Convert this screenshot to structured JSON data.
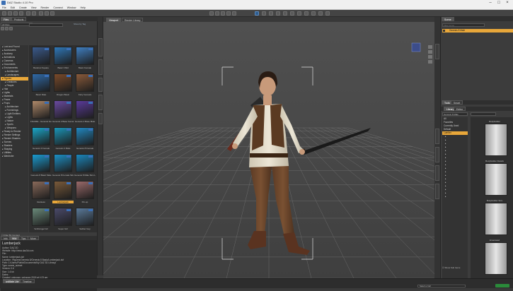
{
  "app": {
    "title": "DAZ Studio 4.10 Pro"
  },
  "menu": [
    "File",
    "Edit",
    "Create",
    "View",
    "Render",
    "Connect",
    "Window",
    "Help"
  ],
  "left_panel": {
    "tabs": [
      "Files",
      "Products"
    ],
    "path_dropdown": "All Files",
    "filter_link": "Show by Tag",
    "tree": [
      {
        "label": "Lost and Found",
        "selected": false
      },
      {
        "label": "Accessories",
        "selected": false
      },
      {
        "label": "Anatomy",
        "selected": false
      },
      {
        "label": "Animations",
        "selected": false
      },
      {
        "label": "Cameras",
        "selected": false
      },
      {
        "label": "Documents",
        "selected": false
      },
      {
        "label": "Environments",
        "selected": false
      },
      {
        "label": "Architecture",
        "selected": false
      },
      {
        "label": "Landscapes",
        "selected": false
      },
      {
        "label": "Figures",
        "selected": true
      },
      {
        "label": "Creatures",
        "selected": false
      },
      {
        "label": "People",
        "selected": false
      },
      {
        "label": "Hair",
        "selected": false
      },
      {
        "label": "Lights",
        "selected": false
      },
      {
        "label": "Materials",
        "selected": false
      },
      {
        "label": "Poses",
        "selected": false
      },
      {
        "label": "Props",
        "selected": false
      },
      {
        "label": "Architecture",
        "selected": false
      },
      {
        "label": "Furnishings",
        "selected": false
      },
      {
        "label": "Light Emitters",
        "selected": false
      },
      {
        "label": "Lights",
        "selected": false
      },
      {
        "label": "Nature",
        "selected": false
      },
      {
        "label": "Sports",
        "selected": false
      },
      {
        "label": "Weapons",
        "selected": false
      },
      {
        "label": "Ready to Render",
        "selected": false
      },
      {
        "label": "Render Settings",
        "selected": false
      },
      {
        "label": "Render Shaders",
        "selected": false
      },
      {
        "label": "Scenes",
        "selected": false
      },
      {
        "label": "Shaders",
        "selected": false
      },
      {
        "label": "Shaping",
        "selected": false
      },
      {
        "label": "Utilities",
        "selected": false
      },
      {
        "label": "Wardrobe",
        "selected": false
      }
    ],
    "filter_by_context": "Filter By Context",
    "thumbnails": [
      {
        "label": "Barefoot Square",
        "color": "#3a5a8c"
      },
      {
        "label": "Basic Child",
        "color": "#2f78b8"
      },
      {
        "label": "Basic Female",
        "color": "#3f7fc0"
      },
      {
        "label": "Basic Male",
        "color": "#2f6aa8"
      },
      {
        "label": "Dragon Basic",
        "color": "#7a4a2a"
      },
      {
        "label": "Fairy Genesis",
        "color": "#8a5a3a"
      },
      {
        "label": "FIGURE - Genesis Female",
        "color": "#b08a6a"
      },
      {
        "label": "Genesis 2 Base Female",
        "color": "#6a4aa0"
      },
      {
        "label": "Genesis 2 Base Male",
        "color": "#5a3a9a"
      },
      {
        "label": "Genesis 3 Female",
        "color": "#1aa6c8"
      },
      {
        "label": "Genesis 3 Male",
        "color": "#1a96b8"
      },
      {
        "label": "Genesis 8 Female",
        "color": "#2088c0"
      },
      {
        "label": "Genesis 8 Basic Male",
        "color": "#1a9bd0"
      },
      {
        "label": "Genesis 8 Female Skin Level",
        "color": "#1c8fc4"
      },
      {
        "label": "Genesis 8 Male Skin Level",
        "color": "#1a86bb"
      },
      {
        "label": "Giantess",
        "color": "#8a6a5a"
      },
      {
        "label": "Lumberjack",
        "color": "#7a5a3a",
        "selected": true
      },
      {
        "label": "Pin-up",
        "color": "#9a6a6a"
      },
      {
        "label": "SciFiAngel G3",
        "color": "#6a8a7a"
      },
      {
        "label": "Super Girl",
        "color": "#4a4a6a"
      },
      {
        "label": "Swiber Guy",
        "color": "#5a7a9a"
      }
    ],
    "detail_tabs": [
      "Info",
      "Wiki",
      "Tips",
      "More"
    ],
    "details": {
      "title": "Lumberjack",
      "rows": [
        "Author:      DAZ 3D",
        "Website:     http://www.daz3d.com",
        "File :",
        "Name:        lumberjack.duf",
        "Location:    /Figures/Genesis 8/Genesis 8 Basic/Lumberjack.duf",
        "Path:        C:/Users/Public/Documents/My DAZ 3D Library/",
        "Type:        scene_subset",
        "Version:     0.6",
        "Size:        1.6 kb",
        "Dates :",
        "Created:     unknown, unknown 2018 at 4:23 am"
      ]
    }
  },
  "viewport": {
    "tabs": [
      "Viewport",
      "Render Library"
    ],
    "view_select": "Perspective View"
  },
  "right_panel": {
    "top_tabs": [
      "Scene"
    ],
    "search": "Filter Items",
    "scene_item": "Genesis 8 Male",
    "mid_tabs": [
      "Tools",
      "Smart"
    ],
    "lower_tabs": [
      "Library",
      "Editor"
    ],
    "group_dropdown": "Genesis 8 Male",
    "groups": [
      "All",
      "Favorites",
      "Currently Used",
      "Default",
      "Lumber"
    ],
    "selected_group": "Lumber",
    "presets": [
      {
        "label": "Bodybuilder"
      },
      {
        "label": "Bodybuilder Details"
      },
      {
        "label": "Bodybuilder Size"
      },
      {
        "label": "Emaciated"
      }
    ],
    "show_sub_items": "Show Sub Items"
  },
  "status": {
    "tabs": [
      "aniMate Lite",
      "Timeline"
    ],
    "progress_label": "Select a Cell"
  }
}
